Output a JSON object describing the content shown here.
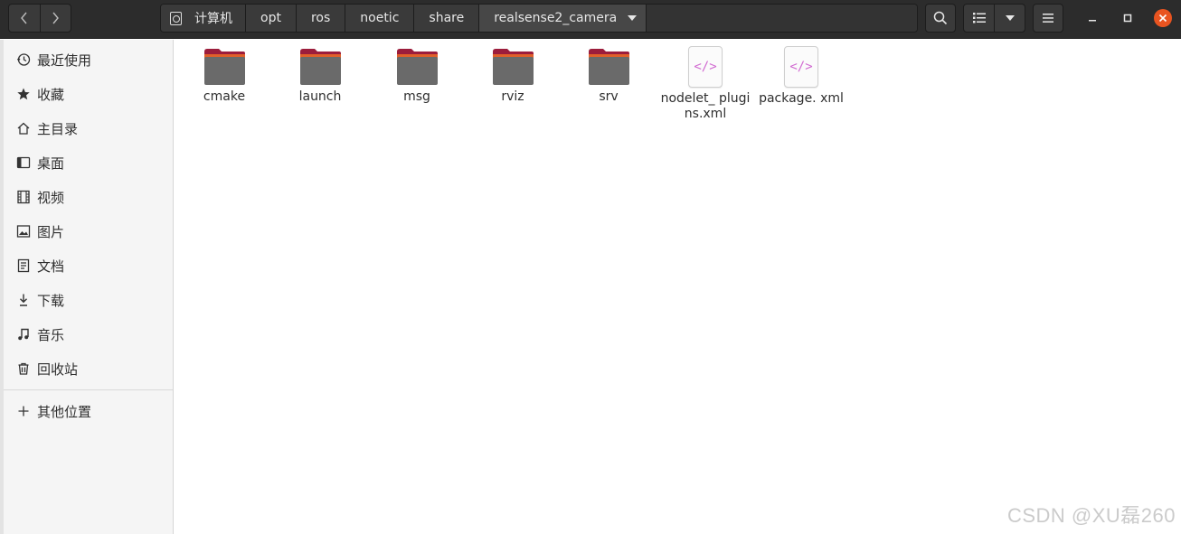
{
  "header": {
    "path": {
      "root": "计算机",
      "segments": [
        "opt",
        "ros",
        "noetic",
        "share"
      ],
      "current": "realsense2_camera"
    },
    "icons": {
      "back": "chevron-left-icon",
      "forward": "chevron-right-icon",
      "search": "search-icon",
      "list_view": "list-view-icon",
      "view_options": "caret-down-icon",
      "menu": "hamburger-menu-icon",
      "minimize": "minimize-icon",
      "maximize": "maximize-icon",
      "close": "close-icon"
    },
    "accent_close": "#e95420"
  },
  "sidebar": {
    "items": [
      {
        "label": "最近使用",
        "icon": "clock-icon"
      },
      {
        "label": "收藏",
        "icon": "star-icon"
      },
      {
        "label": "主目录",
        "icon": "home-icon"
      },
      {
        "label": "桌面",
        "icon": "desktop-icon"
      },
      {
        "label": "视频",
        "icon": "video-icon"
      },
      {
        "label": "图片",
        "icon": "picture-icon"
      },
      {
        "label": "文档",
        "icon": "document-icon"
      },
      {
        "label": "下载",
        "icon": "download-icon"
      },
      {
        "label": "音乐",
        "icon": "music-icon"
      },
      {
        "label": "回收站",
        "icon": "trash-icon"
      }
    ],
    "other": {
      "label": "其他位置",
      "icon": "plus-icon"
    }
  },
  "files": [
    {
      "name": "cmake",
      "type": "folder"
    },
    {
      "name": "launch",
      "type": "folder"
    },
    {
      "name": "msg",
      "type": "folder"
    },
    {
      "name": "rviz",
      "type": "folder"
    },
    {
      "name": "srv",
      "type": "folder"
    },
    {
      "name": "nodelet_ plugins.xml",
      "type": "xml"
    },
    {
      "name": "package. xml",
      "type": "xml"
    }
  ],
  "folder_colors": {
    "top": "#9c1d3c",
    "body": "#6a6a6a",
    "edge": "#e0602a"
  },
  "watermark": "CSDN @XU磊260"
}
